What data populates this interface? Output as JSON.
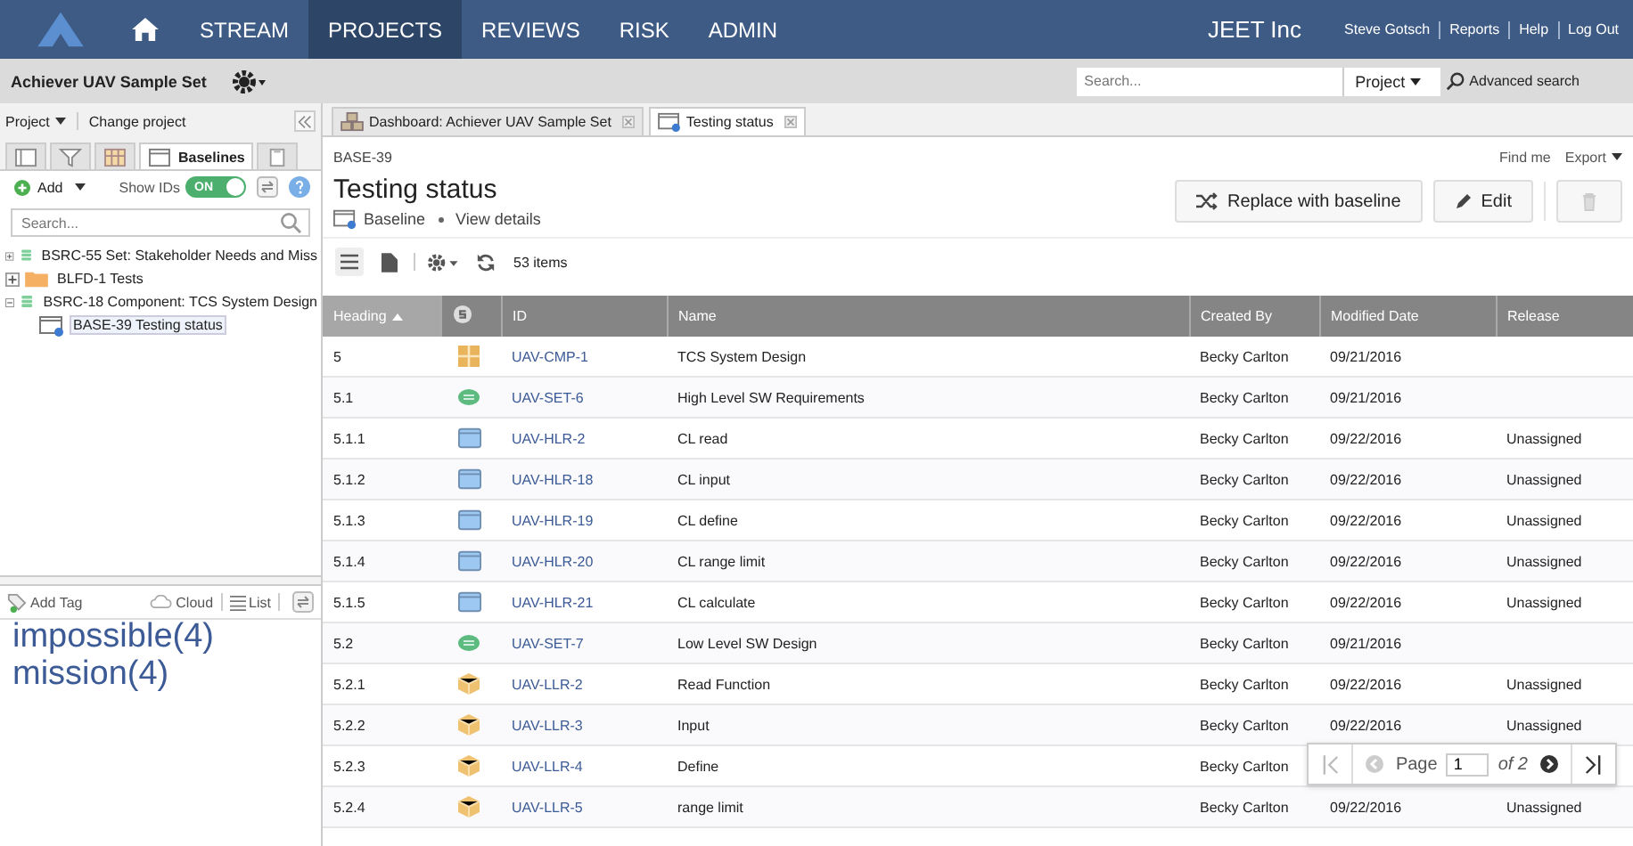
{
  "nav": {
    "items": [
      {
        "label": "STREAM",
        "selected": false
      },
      {
        "label": "PROJECTS",
        "selected": true
      },
      {
        "label": "REVIEWS",
        "selected": false
      },
      {
        "label": "RISK",
        "selected": false
      },
      {
        "label": "ADMIN",
        "selected": false
      }
    ],
    "company": "JEET Inc",
    "links": [
      "Steve Gotsch",
      "Reports",
      "Help",
      "Log Out"
    ]
  },
  "subbar": {
    "project": "Achiever UAV Sample Set",
    "search": {
      "placeholder": "Search..."
    },
    "scope": "Project",
    "advanced": "Advanced search"
  },
  "sidebar": {
    "project_menu": "Project",
    "change_project": "Change project",
    "tabs": [
      {
        "kind": "list",
        "selected": false
      },
      {
        "kind": "filter",
        "selected": false
      },
      {
        "kind": "grid",
        "selected": false
      },
      {
        "kind": "baseline",
        "label": "Baselines",
        "selected": true
      },
      {
        "kind": "clipboard",
        "selected": false
      }
    ],
    "add": "Add",
    "show_ids": {
      "label": "Show IDs",
      "state": "ON",
      "on": true
    },
    "search": {
      "placeholder": "Search..."
    },
    "tree": [
      {
        "label": "BSRC-55 Set: Stakeholder Needs and Miss",
        "kind": "set",
        "expanded": false,
        "selected": false
      },
      {
        "label": "BLFD-1 Tests",
        "kind": "folder",
        "expanded": false,
        "selected": false
      },
      {
        "label": "BSRC-18 Component: TCS System Design",
        "kind": "set",
        "expanded": true,
        "selected": false,
        "children": [
          {
            "label": "BASE-39 Testing status",
            "kind": "baseline",
            "selected": true
          }
        ]
      }
    ],
    "tags_bar": {
      "add": "Add Tag",
      "cloud": "Cloud",
      "list": "List"
    },
    "tags": [
      "impossible(4)",
      "mission(4)"
    ]
  },
  "doc_tabs": [
    {
      "label": "Dashboard: Achiever UAV Sample Set",
      "kind": "dashboard",
      "selected": false
    },
    {
      "label": "Testing status",
      "kind": "baseline",
      "selected": true
    }
  ],
  "content": {
    "id": "BASE-39",
    "find_me": "Find me",
    "export": "Export",
    "title": "Testing status",
    "type": "Baseline",
    "details": "View details",
    "buttons": {
      "replace": "Replace with baseline",
      "edit": "Edit"
    },
    "count": "53 items"
  },
  "table": {
    "columns": [
      "Heading",
      "ID",
      "Name",
      "Created By",
      "Modified Date",
      "Release"
    ],
    "rows": [
      {
        "heading": "5",
        "kind": "component",
        "id": "UAV-CMP-1",
        "name": "TCS System Design",
        "created_by": "Becky Carlton",
        "modified": "09/21/2016"
      },
      {
        "heading": "5.1",
        "kind": "set",
        "id": "UAV-SET-6",
        "name": "High Level SW Requirements",
        "created_by": "Becky Carlton",
        "modified": "09/21/2016"
      },
      {
        "heading": "5.1.1",
        "kind": "window",
        "id": "UAV-HLR-2",
        "name": "CL read",
        "created_by": "Becky Carlton",
        "modified": "09/22/2016",
        "release": "Unassigned"
      },
      {
        "heading": "5.1.2",
        "kind": "window",
        "id": "UAV-HLR-18",
        "name": "CL input",
        "created_by": "Becky Carlton",
        "modified": "09/22/2016",
        "release": "Unassigned"
      },
      {
        "heading": "5.1.3",
        "kind": "window",
        "id": "UAV-HLR-19",
        "name": "CL define",
        "created_by": "Becky Carlton",
        "modified": "09/22/2016",
        "release": "Unassigned"
      },
      {
        "heading": "5.1.4",
        "kind": "window",
        "id": "UAV-HLR-20",
        "name": "CL range limit",
        "created_by": "Becky Carlton",
        "modified": "09/22/2016",
        "release": "Unassigned"
      },
      {
        "heading": "5.1.5",
        "kind": "window",
        "id": "UAV-HLR-21",
        "name": "CL calculate",
        "created_by": "Becky Carlton",
        "modified": "09/22/2016",
        "release": "Unassigned"
      },
      {
        "heading": "5.2",
        "kind": "set",
        "id": "UAV-SET-7",
        "name": "Low Level SW Design",
        "created_by": "Becky Carlton",
        "modified": "09/21/2016"
      },
      {
        "heading": "5.2.1",
        "kind": "box",
        "id": "UAV-LLR-2",
        "name": "Read Function",
        "created_by": "Becky Carlton",
        "modified": "09/22/2016",
        "release": "Unassigned"
      },
      {
        "heading": "5.2.2",
        "kind": "box",
        "id": "UAV-LLR-3",
        "name": "Input",
        "created_by": "Becky Carlton",
        "modified": "09/22/2016",
        "release": "Unassigned"
      },
      {
        "heading": "5.2.3",
        "kind": "box",
        "id": "UAV-LLR-4",
        "name": "Define",
        "created_by": "Becky Carlton"
      },
      {
        "heading": "5.2.4",
        "kind": "box",
        "id": "UAV-LLR-5",
        "name": "range limit",
        "created_by": "Becky Carlton",
        "modified": "09/22/2016",
        "release": "Unassigned"
      }
    ]
  },
  "pager": {
    "label": "Page",
    "value": "1",
    "of": "of 2"
  }
}
